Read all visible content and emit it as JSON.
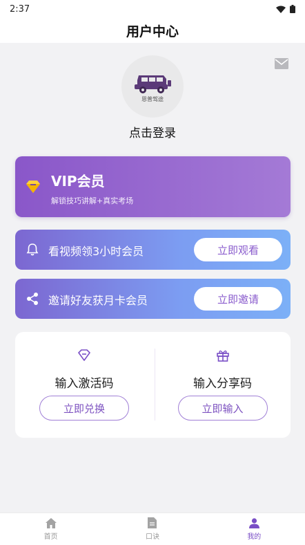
{
  "status_bar": {
    "time": "2:37"
  },
  "header": {
    "title": "用户中心"
  },
  "profile": {
    "avatar_caption": "恩普驾途",
    "login_text": "点击登录"
  },
  "vip": {
    "title": "VIP会员",
    "subtitle": "解锁技巧讲解+真实考场"
  },
  "promos": [
    {
      "icon": "bell-icon",
      "text": "看视频领3小时会员",
      "button": "立即观看"
    },
    {
      "icon": "share-icon",
      "text": "邀请好友获月卡会员",
      "button": "立即邀请"
    }
  ],
  "codes": [
    {
      "icon": "diamond-icon",
      "label": "输入激活码",
      "button": "立即兑换"
    },
    {
      "icon": "gift-icon",
      "label": "输入分享码",
      "button": "立即输入"
    }
  ],
  "tabs": [
    {
      "icon": "home-icon",
      "label": "首页",
      "active": false
    },
    {
      "icon": "document-icon",
      "label": "口诀",
      "active": false
    },
    {
      "icon": "person-icon",
      "label": "我的",
      "active": true
    }
  ],
  "colors": {
    "accent": "#7a4fc6",
    "vip_gradient_start": "#8a57c9",
    "vip_gradient_end": "#a47ad6",
    "promo_gradient_start": "#7c67d1",
    "promo_gradient_end": "#7cb0f7",
    "background": "#f2f2f4"
  }
}
